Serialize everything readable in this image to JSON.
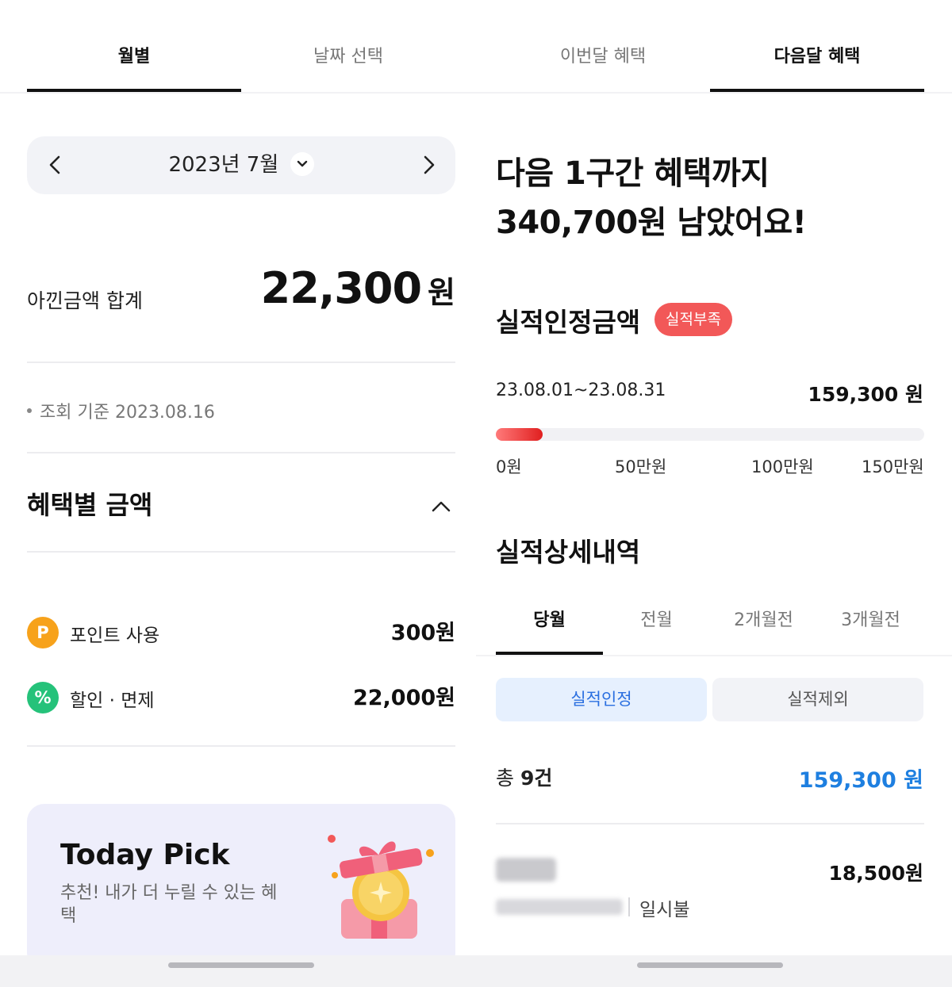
{
  "left": {
    "tabs": [
      {
        "label": "월별",
        "active": true
      },
      {
        "label": "날짜 선택",
        "active": false
      }
    ],
    "month_selector": {
      "label": "2023년 7월"
    },
    "savings": {
      "label": "아낀금액 합계",
      "amount": "22,300",
      "unit": "원"
    },
    "reference_date": "조회 기준 2023.08.16",
    "benefit_section": {
      "title": "혜택별 금액"
    },
    "benefits": [
      {
        "icon": "point-icon",
        "icon_glyph": "P",
        "icon_color": "#f7a21b",
        "label": "포인트 사용",
        "amount": "300원"
      },
      {
        "icon": "percent-icon",
        "icon_glyph": "%",
        "icon_color": "#25c27a",
        "label": "할인 · 면제",
        "amount": "22,000원"
      }
    ],
    "today_pick": {
      "title": "Today Pick",
      "description": "추천! 내가 더 누릴 수 있는 혜택"
    }
  },
  "right": {
    "tabs": [
      {
        "label": "이번달 혜택",
        "active": false
      },
      {
        "label": "다음달 혜택",
        "active": true
      }
    ],
    "headline_line1": "다음 1구간 혜택까지",
    "headline_line2": "340,700원 남았어요!",
    "performance": {
      "title": "실적인정금액",
      "badge": "실적부족",
      "badge_color": "#f25858",
      "period": "23.08.01~23.08.31",
      "amount": "159,300 원",
      "progress_fraction": 0.11,
      "ticks": [
        "0원",
        "50만원",
        "100만원",
        "150만원"
      ]
    },
    "detail": {
      "title": "실적상세내역",
      "tabs": [
        "당월",
        "전월",
        "2개월전",
        "3개월전"
      ],
      "active_tab": "당월",
      "segments": {
        "included": "실적인정",
        "excluded": "실적제외"
      },
      "total_prefix": "총 ",
      "total_count": "9건",
      "total_amount": "159,300 원",
      "total_amount_color": "#1e7fe0",
      "transactions": [
        {
          "amount": "18,500원",
          "type": "일시불"
        }
      ]
    }
  }
}
